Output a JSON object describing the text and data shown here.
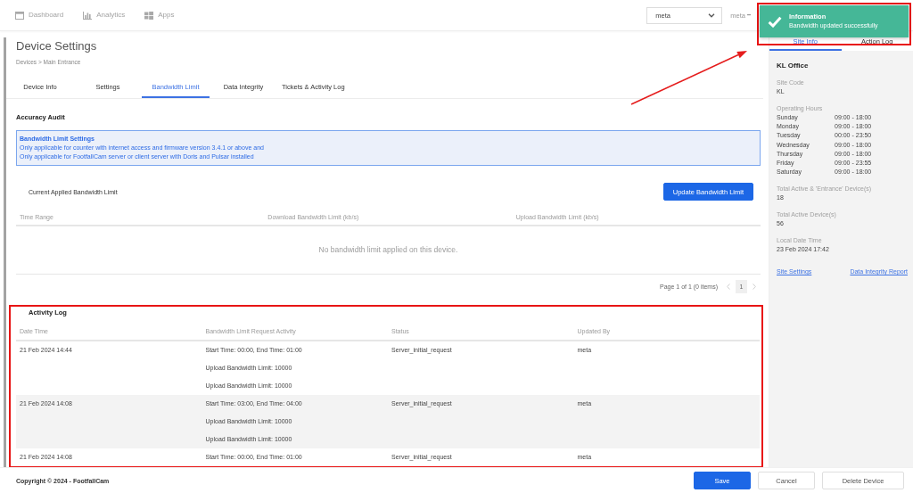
{
  "nav": {
    "items": [
      {
        "label": "Dashboard",
        "kind": "dashboard"
      },
      {
        "label": "Analytics",
        "kind": "analytics"
      },
      {
        "label": "Apps",
        "kind": "apps"
      }
    ],
    "site_select": {
      "value": "meta"
    },
    "user_menu": "meta"
  },
  "toast": {
    "title": "Information",
    "message": "Bandwidth updated successfully",
    "highlighted": true
  },
  "page": {
    "title": "Device Settings",
    "breadcrumb": "Devices > Main Entrance"
  },
  "tabs": [
    {
      "label": "Device Info",
      "selected": false
    },
    {
      "label": "Settings",
      "selected": false
    },
    {
      "label": "Bandwidth Limit",
      "selected": true
    },
    {
      "label": "Data Integrity",
      "selected": false
    },
    {
      "label": "Tickets & Activity Log",
      "selected": false
    }
  ],
  "section_title": "Accuracy Audit",
  "notice": {
    "title": "Bandwidth Limit Settings",
    "lines": [
      "Only applicable for counter with internet access and firmware version 3.4.1 or above and",
      "Only applicable for FootfallCam server or client server with Doris and Pulsar installed"
    ]
  },
  "bandwidth": {
    "title": "Current Applied Bandwidth Limit",
    "button": "Update Bandwidth Limit",
    "columns": [
      "Time Range",
      "Download Bandwidth Limit (kb/s)",
      "Upload Bandwidth Limit (kb/s)"
    ],
    "empty_message": "No bandwidth limit applied on this device.",
    "pagination": {
      "summary": "Page 1 of 1 (0 items)",
      "pages": [
        {
          "label": "1",
          "selected": true
        }
      ]
    }
  },
  "activity_log": {
    "title": "Activity Log",
    "highlighted": true,
    "columns": [
      "Date Time",
      "Bandwidth Limit Request Activity",
      "Status",
      "Updated By"
    ],
    "rows": [
      {
        "date_time": "21 Feb 2024 14:44",
        "activity": [
          "Start Time: 00:00, End Time: 01:00",
          "Upload Bandwidth Limit: 10000",
          "Upload Bandwidth Limit: 10000"
        ],
        "status": "Server_initial_request",
        "updated_by": "meta"
      },
      {
        "date_time": "21 Feb 2024 14:08",
        "activity": [
          "Start Time: 03:00, End Time: 04:00",
          "Upload Bandwidth Limit: 10000",
          "Upload Bandwidth Limit: 10000"
        ],
        "status": "Server_initial_request",
        "updated_by": "meta"
      },
      {
        "date_time": "21 Feb 2024 14:08",
        "activity": [
          "Start Time: 00:00, End Time: 01:00"
        ],
        "status": "Server_initial_request",
        "updated_by": "meta"
      }
    ]
  },
  "footer": {
    "copyright": "Copyright © 2024 - FootfallCam",
    "buttons": [
      {
        "label": "Save",
        "kind": "save"
      },
      {
        "label": "Cancel",
        "kind": "cancel"
      },
      {
        "label": "Delete Device",
        "kind": "delete"
      }
    ]
  },
  "side_panel": {
    "tabs": [
      {
        "label": "Site Info",
        "selected": true
      },
      {
        "label": "Action Log",
        "selected": false
      }
    ],
    "site_name": "KL Office",
    "details": [
      {
        "kind": "value",
        "label": "Site Code",
        "value": "KL"
      },
      {
        "kind": "schedule",
        "label": "Operating Hours",
        "days": [
          {
            "day": "Sunday",
            "hours": "09:00 - 18:00"
          },
          {
            "day": "Monday",
            "hours": "09:00 - 18:00"
          },
          {
            "day": "Tuesday",
            "hours": "00:00 - 23:50"
          },
          {
            "day": "Wednesday",
            "hours": "09:00 - 18:00"
          },
          {
            "day": "Thursday",
            "hours": "09:00 - 18:00"
          },
          {
            "day": "Friday",
            "hours": "09:00 - 23:55"
          },
          {
            "day": "Saturday",
            "hours": "09:00 - 18:00"
          }
        ]
      },
      {
        "kind": "value",
        "label": "Total Active & 'Entrance' Device(s)",
        "value": "18"
      },
      {
        "kind": "value",
        "label": "Total Active Device(s)",
        "value": "56"
      },
      {
        "kind": "value",
        "label": "Local Date Time",
        "value": "23 Feb 2024 17:42"
      }
    ],
    "links": [
      "Site Settings",
      "Data Integrity Report"
    ]
  }
}
